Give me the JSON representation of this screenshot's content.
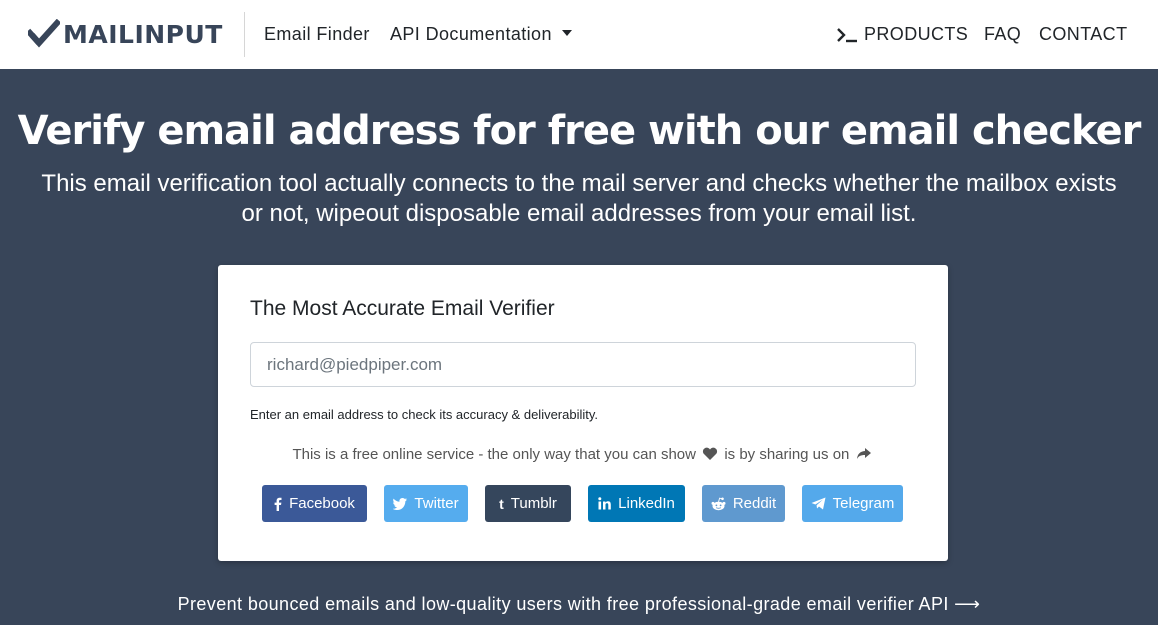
{
  "navbar": {
    "logo_text": "MAILINPUT",
    "links": {
      "email_finder": "Email Finder",
      "api_docs": "API Documentation",
      "products": "PRODUCTS",
      "faq": "FAQ",
      "contact": "CONTACT"
    }
  },
  "hero": {
    "title": "Verify email address for free with our email checker",
    "subtitle": "This email verification tool actually connects to the mail server and checks whether the mailbox exists or not, wipeout disposable email addresses from your email list."
  },
  "verifier": {
    "title": "The Most Accurate Email Verifier",
    "input_placeholder": "richard@piedpiper.com",
    "input_value": "",
    "help_text": "Enter an email address to check its accuracy & deliverability.",
    "share_prefix": "This is a free online service - the only way that you can show",
    "share_middle": "is by sharing us on"
  },
  "social_buttons": {
    "facebook": "Facebook",
    "twitter": "Twitter",
    "tumblr": "Tumblr",
    "linkedin": "LinkedIn",
    "reddit": "Reddit",
    "telegram": "Telegram"
  },
  "footer_link": {
    "text": "Prevent bounced emails and low-quality users with free professional-grade email verifier API",
    "arrow": "⟶"
  },
  "colors": {
    "background": "#384559",
    "facebook": "#3b5998",
    "twitter": "#55acee",
    "tumblr": "#35465c",
    "linkedin": "#0077b5",
    "reddit": "#5f99cf",
    "telegram": "#54a9eb"
  },
  "icons": [
    "check-logo-icon",
    "caret-down-icon",
    "terminal-icon",
    "heart-icon",
    "share-arrow-icon",
    "facebook-icon",
    "twitter-icon",
    "tumblr-icon",
    "linkedin-icon",
    "reddit-icon",
    "telegram-icon",
    "arrow-right-icon"
  ]
}
